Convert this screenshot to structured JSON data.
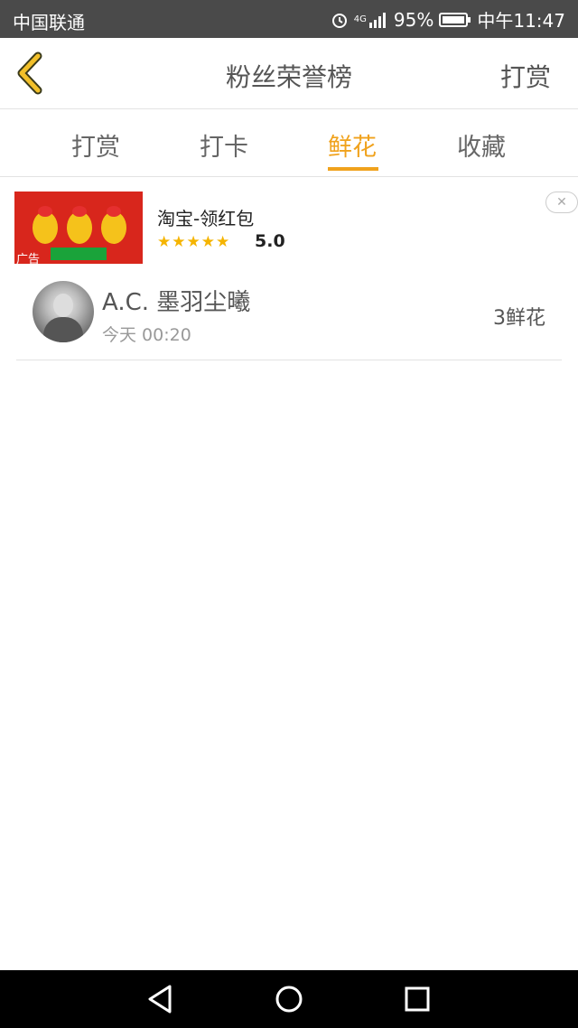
{
  "status_bar": {
    "carrier": "中国联通",
    "network": "4G",
    "battery": "95%",
    "time": "中午11:47"
  },
  "header": {
    "title": "粉丝荣誉榜",
    "action": "打赏"
  },
  "tabs": [
    {
      "label": "打赏",
      "active": false
    },
    {
      "label": "打卡",
      "active": false
    },
    {
      "label": "鲜花",
      "active": true
    },
    {
      "label": "收藏",
      "active": false
    }
  ],
  "ad": {
    "title": "淘宝-领红包",
    "stars": "★★★★★",
    "rating": "5.0",
    "tag": "广告",
    "close": "✕"
  },
  "rankings": [
    {
      "name": "A.C. 墨羽尘曦",
      "time": "今天 00:20",
      "count": "3鲜花"
    }
  ],
  "colors": {
    "accent": "#f0a21c",
    "status_bar": "#4a4a4a"
  }
}
